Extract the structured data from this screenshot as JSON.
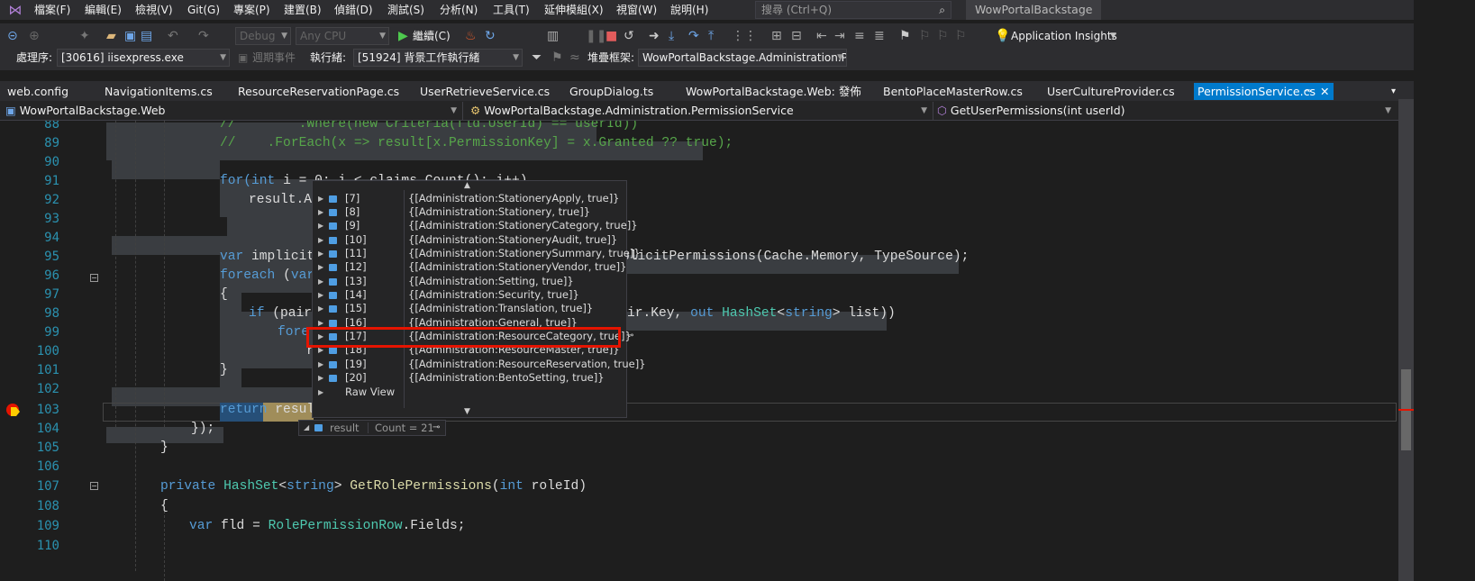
{
  "menubar": {
    "items": [
      "檔案(F)",
      "編輯(E)",
      "檢視(V)",
      "Git(G)",
      "專案(P)",
      "建置(B)",
      "偵錯(D)",
      "測試(S)",
      "分析(N)",
      "工具(T)",
      "延伸模組(X)",
      "視窗(W)",
      "說明(H)"
    ],
    "search_placeholder": "搜尋 (Ctrl+Q)",
    "solution_name": "WowPortalBackstage"
  },
  "toolbar": {
    "config": "Debug",
    "platform": "Any CPU",
    "continue_label": "繼續(C)",
    "insights_label": "Application Insights"
  },
  "debugbar": {
    "process_label": "處理序:",
    "process_value": "[30616] iisexpress.exe",
    "lifecycle_label": "週期事件",
    "thread_label": "執行緒:",
    "thread_value": "[51924] 背景工作執行緒",
    "stack_label": "堆疊框架:",
    "stack_value": "WowPortalBackstage.Administration.Pe"
  },
  "tabs": [
    "web.config",
    "NavigationItems.cs",
    "ResourceReservationPage.cs",
    "UserRetrieveService.cs",
    "GroupDialog.ts",
    "WowPortalBackstage.Web: 發佈",
    "BentoPlaceMasterRow.cs",
    "UserCultureProvider.cs",
    "PermissionService.cs"
  ],
  "navbar": {
    "project": "WowPortalBackstage.Web",
    "type": "WowPortalBackstage.Administration.PermissionService",
    "member": "GetUserPermissions(int userId)"
  },
  "editor": {
    "line_numbers": [
      "88",
      "89",
      "90",
      "91",
      "92",
      "93",
      "94",
      "95",
      "96",
      "97",
      "98",
      "99",
      "100",
      "101",
      "102",
      "103",
      "104",
      "105",
      "106",
      "107",
      "108",
      "109",
      "110"
    ],
    "code": {
      "l88": "//        .Where(new Criteria(fld.UserId) == userId))",
      "l89": "//    .ForEach(x => result[x.PermissionKey] = x.Granted ?? true);",
      "l91a": "for(",
      "l91b": "int",
      "l91c": " i = 0; i < claims.Count(); i++)",
      "l92": "result.Ad",
      "l95a": "var",
      "l95b": " implicitP",
      "l95c": "plicitPermissions(Cache.Memory, TypeSource);",
      "l96a": "foreach",
      "l96b": " (",
      "l96c": "var",
      "l97": "{",
      "l98a": "if",
      "l98b": " (pair.",
      "l98c": "ir.Key, ",
      "l98d": "out",
      "l98e": " ",
      "l98f": "HashSet",
      "l98g": "<",
      "l98h": "string",
      "l98i": "> list))",
      "l99": "fore",
      "l100": "r",
      "l101": "}",
      "l103a": "return",
      "l103b": " result",
      "l104": "});",
      "l105": "}",
      "l107a": "private",
      "l107b": "HashSet",
      "l107c": "<",
      "l107d": "string",
      "l107e": "> ",
      "l107f": "GetRolePermissions",
      "l107g": "(",
      "l107h": "int",
      "l107i": " roleId)",
      "l108": "{",
      "l109a": "var",
      "l109b": " fld = ",
      "l109c": "RolePermissionRow",
      "l109d": ".Fields;"
    }
  },
  "datatip": {
    "rows": [
      {
        "name": "[7]",
        "value": "{[Administration:StationeryApply, true]}"
      },
      {
        "name": "[8]",
        "value": "{[Administration:Stationery, true]}"
      },
      {
        "name": "[9]",
        "value": "{[Administration:StationeryCategory, true]}"
      },
      {
        "name": "[10]",
        "value": "{[Administration:StationeryAudit, true]}"
      },
      {
        "name": "[11]",
        "value": "{[Administration:StationerySummary, true]}"
      },
      {
        "name": "[12]",
        "value": "{[Administration:StationeryVendor, true]}"
      },
      {
        "name": "[13]",
        "value": "{[Administration:Setting, true]}"
      },
      {
        "name": "[14]",
        "value": "{[Administration:Security, true]}"
      },
      {
        "name": "[15]",
        "value": "{[Administration:Translation, true]}"
      },
      {
        "name": "[16]",
        "value": "{[Administration:General, true]}"
      },
      {
        "name": "[17]",
        "value": "{[Administration:ResourceCategory, true]}"
      },
      {
        "name": "[18]",
        "value": "{[Administration:ResourceMaster, true]}"
      },
      {
        "name": "[19]",
        "value": "{[Administration:ResourceReservation, true]}"
      },
      {
        "name": "[20]",
        "value": "{[Administration:BentoSetting, true]}"
      }
    ],
    "raw_view": "Raw View",
    "result_name": "result",
    "result_count": "Count = 21"
  }
}
